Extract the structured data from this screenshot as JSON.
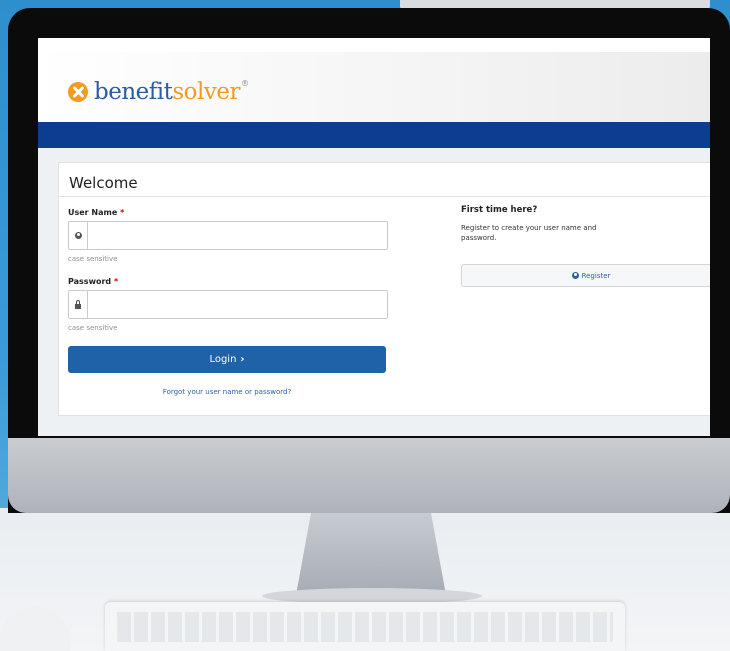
{
  "brand": {
    "name_part1": "benefit",
    "name_part2": "solver",
    "trademark": "®",
    "primary_color": "#2d5aa3",
    "accent_color": "#f29a22",
    "bar_color": "#0d3d8f"
  },
  "card": {
    "title": "Welcome"
  },
  "form": {
    "username_label": "User Name",
    "username_hint": "case sensitive",
    "password_label": "Password",
    "password_hint": "case sensitive",
    "required_marker": "*",
    "username_value": "",
    "password_value": "",
    "login_label": "Login",
    "login_chevron": "›",
    "forgot_link": "Forgot your user name or password?"
  },
  "register": {
    "title": "First time here?",
    "description": "Register to create your user name and password.",
    "button_label": "Register"
  },
  "icons": {
    "logo": "benefitsolver-logo-icon",
    "user": "user-icon",
    "lock": "lock-icon",
    "chevron": "chevron-right-icon",
    "register": "user-circle-icon"
  }
}
